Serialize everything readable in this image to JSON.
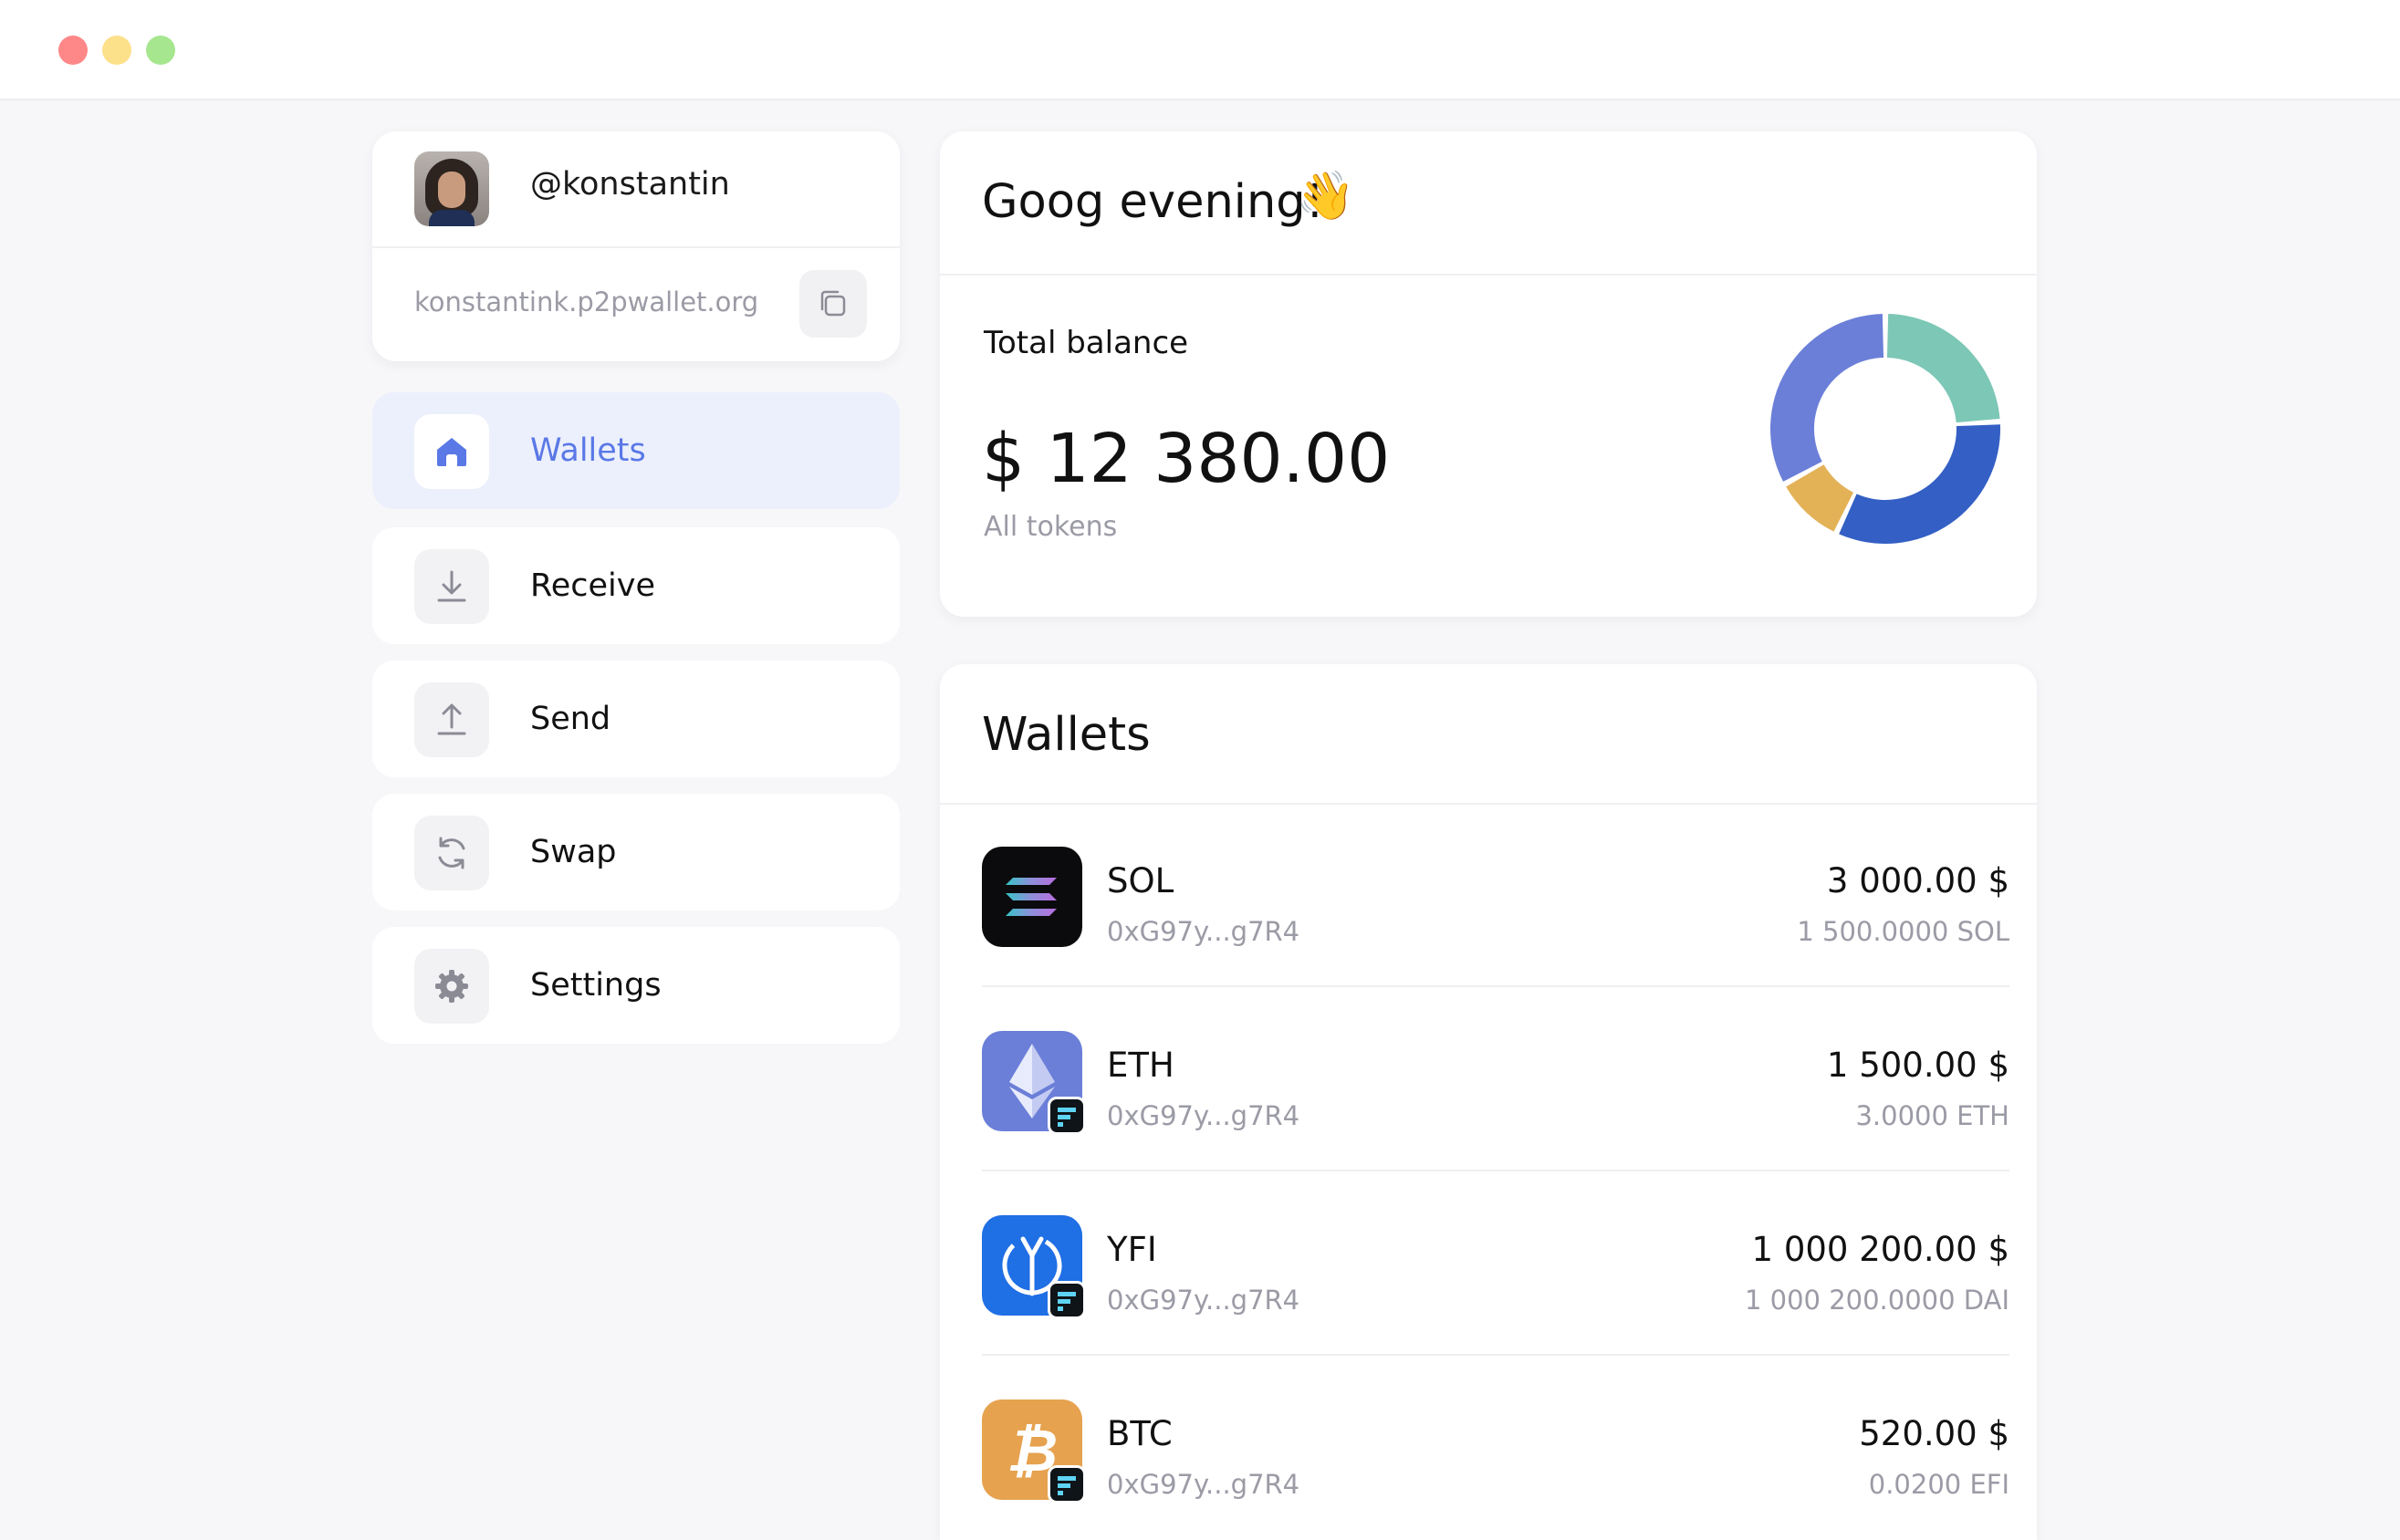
{
  "profile": {
    "handle": "@konstantin",
    "domain": "konstantink.p2pwallet.org"
  },
  "nav": [
    {
      "label": "Wallets",
      "icon": "home-icon",
      "active": true
    },
    {
      "label": "Receive",
      "icon": "download-icon",
      "active": false
    },
    {
      "label": "Send",
      "icon": "upload-icon",
      "active": false
    },
    {
      "label": "Swap",
      "icon": "refresh-icon",
      "active": false
    },
    {
      "label": "Settings",
      "icon": "gear-icon",
      "active": false
    }
  ],
  "greeting": {
    "text": "Goog evening!",
    "emoji": "👋"
  },
  "balance": {
    "label": "Total balance",
    "value": "$ 12 380.00",
    "sub": "All tokens"
  },
  "chart_data": {
    "type": "pie",
    "variant": "donut",
    "categories": [
      "SOL",
      "ETH",
      "YFI",
      "BTC"
    ],
    "values": [
      24,
      33,
      10,
      33
    ],
    "colors": [
      "#7cc7b5",
      "#345fc4",
      "#e3b257",
      "#6b7fd8"
    ]
  },
  "wallets": {
    "title": "Wallets",
    "items": [
      {
        "symbol": "SOL",
        "address": "0xG97y...g7R4",
        "usd": "3 000.00 $",
        "amount": "1 500.0000 SOL",
        "icon": "solana-logo-icon",
        "color": "#0b0b0d"
      },
      {
        "symbol": "ETH",
        "address": "0xG97y...g7R4",
        "usd": "1 500.00 $",
        "amount": "3.0000 ETH",
        "icon": "ethereum-logo-icon",
        "color": "#6b7fd8"
      },
      {
        "symbol": "YFI",
        "address": "0xG97y...g7R4",
        "usd": "1 000 200.00 $",
        "amount": "1 000 200.0000 DAI",
        "icon": "yearn-logo-icon",
        "color": "#1f6fe5"
      },
      {
        "symbol": "BTC",
        "address": "0xG97y...g7R4",
        "usd": "520.00 $",
        "amount": "0.0200 EFI",
        "icon": "bitcoin-logo-icon",
        "color": "#e6a24f"
      }
    ]
  },
  "colors": {
    "accent": "#5a78e6",
    "active_bg": "#ecf0fc",
    "muted_text": "#9b9ba6"
  }
}
